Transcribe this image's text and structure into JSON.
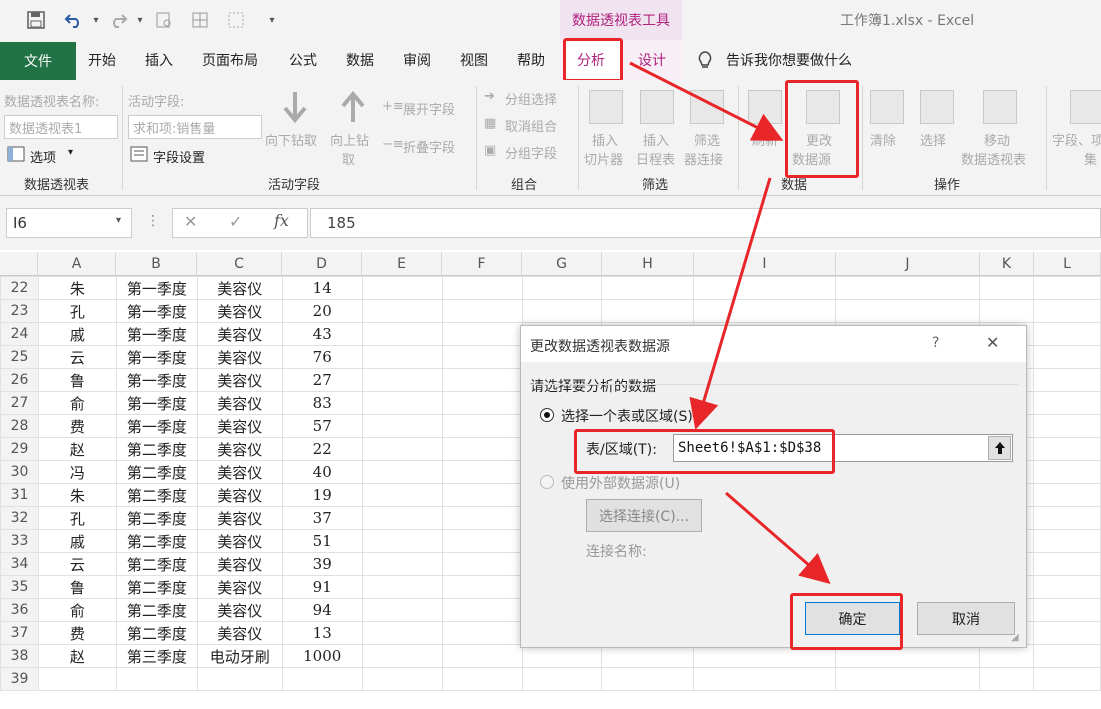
{
  "titlebar": {
    "tool_context": "数据透视表工具",
    "doc_title": "工作簿1.xlsx  -  Excel"
  },
  "tabs": {
    "file": "文件",
    "home": "开始",
    "insert": "插入",
    "page_layout": "页面布局",
    "formulas": "公式",
    "data": "数据",
    "review": "审阅",
    "view": "视图",
    "help": "帮助",
    "analyze": "分析",
    "design": "设计",
    "tell_me": "告诉我你想要做什么"
  },
  "ribbon": {
    "pivot_name_label": "数据透视表名称:",
    "pivot_name_value": "数据透视表1",
    "options": "选项",
    "active_field_label": "活动字段:",
    "active_field_value": "求和项:销售量",
    "field_settings": "字段设置",
    "drill_down_1": "向下钻取",
    "drill_up_1": "向上钻",
    "drill_up_2": "取",
    "expand_field": "展开字段",
    "collapse_field": "折叠字段",
    "group_selection": "分组选择",
    "ungroup": "取消组合",
    "group_field": "分组字段",
    "insert_slicer_1": "插入",
    "insert_slicer_2": "切片器",
    "insert_timeline_1": "插入",
    "insert_timeline_2": "日程表",
    "filter_conn_1": "筛选",
    "filter_conn_2": "器连接",
    "refresh": "刷新",
    "change_source_1": "更改",
    "change_source_2": "数据源",
    "clear": "清除",
    "select": "选择",
    "move_pivot_1": "移动",
    "move_pivot_2": "数据透视表",
    "fields_items_1": "字段、项",
    "fields_items_2": "集",
    "group_pivot": "数据透视表",
    "group_active_field": "活动字段",
    "group_group": "组合",
    "group_filter": "筛选",
    "group_data": "数据",
    "group_actions": "操作"
  },
  "formula_bar": {
    "name_box": "I6",
    "value": "185"
  },
  "columns": [
    "A",
    "B",
    "C",
    "D",
    "E",
    "F",
    "G",
    "H",
    "I",
    "J",
    "K",
    "L"
  ],
  "rows": [
    {
      "n": "22",
      "a": "朱",
      "b": "第一季度",
      "c": "美容仪",
      "d": "14"
    },
    {
      "n": "23",
      "a": "孔",
      "b": "第一季度",
      "c": "美容仪",
      "d": "20"
    },
    {
      "n": "24",
      "a": "戚",
      "b": "第一季度",
      "c": "美容仪",
      "d": "43"
    },
    {
      "n": "25",
      "a": "云",
      "b": "第一季度",
      "c": "美容仪",
      "d": "76"
    },
    {
      "n": "26",
      "a": "鲁",
      "b": "第一季度",
      "c": "美容仪",
      "d": "27"
    },
    {
      "n": "27",
      "a": "俞",
      "b": "第一季度",
      "c": "美容仪",
      "d": "83"
    },
    {
      "n": "28",
      "a": "费",
      "b": "第一季度",
      "c": "美容仪",
      "d": "57"
    },
    {
      "n": "29",
      "a": "赵",
      "b": "第二季度",
      "c": "美容仪",
      "d": "22"
    },
    {
      "n": "30",
      "a": "冯",
      "b": "第二季度",
      "c": "美容仪",
      "d": "40"
    },
    {
      "n": "31",
      "a": "朱",
      "b": "第二季度",
      "c": "美容仪",
      "d": "19"
    },
    {
      "n": "32",
      "a": "孔",
      "b": "第二季度",
      "c": "美容仪",
      "d": "37"
    },
    {
      "n": "33",
      "a": "戚",
      "b": "第二季度",
      "c": "美容仪",
      "d": "51"
    },
    {
      "n": "34",
      "a": "云",
      "b": "第二季度",
      "c": "美容仪",
      "d": "39"
    },
    {
      "n": "35",
      "a": "鲁",
      "b": "第二季度",
      "c": "美容仪",
      "d": "91"
    },
    {
      "n": "36",
      "a": "俞",
      "b": "第二季度",
      "c": "美容仪",
      "d": "94"
    },
    {
      "n": "37",
      "a": "费",
      "b": "第二季度",
      "c": "美容仪",
      "d": "13"
    },
    {
      "n": "38",
      "a": "赵",
      "b": "第三季度",
      "c": "电动牙刷",
      "d": "1000"
    },
    {
      "n": "39",
      "a": "",
      "b": "",
      "c": "",
      "d": ""
    }
  ],
  "dialog": {
    "title": "更改数据透视表数据源",
    "help": "?",
    "prompt": "请选择要分析的数据",
    "option_table": "选择一个表或区域(S)",
    "range_label": "表/区域(T):",
    "range_value": "Sheet6!$A$1:$D$38",
    "option_external": "使用外部数据源(U)",
    "choose_connection": "选择连接(C)...",
    "connection_name": "连接名称:",
    "ok": "确定",
    "cancel": "取消"
  },
  "colors": {
    "excel_green": "#217346",
    "context_tab": "#b0237f",
    "annotation_red": "#e8262a"
  }
}
